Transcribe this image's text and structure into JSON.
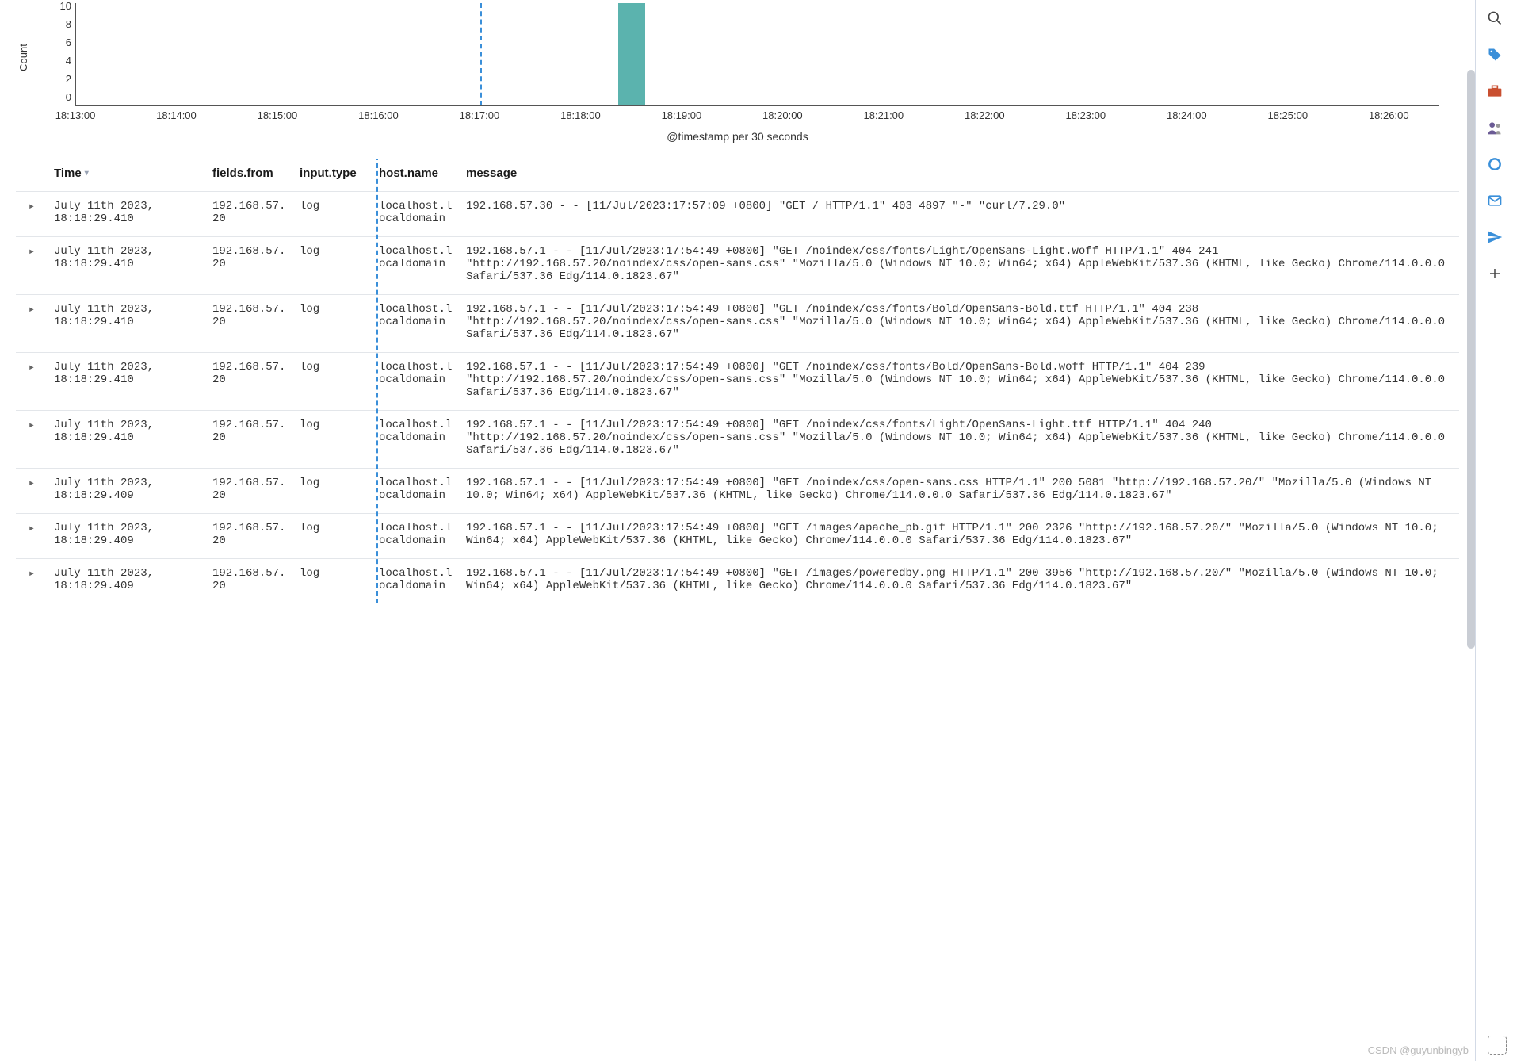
{
  "chart_data": {
    "type": "bar",
    "xlabel": "@timestamp per 30 seconds",
    "ylabel": "Count",
    "y_ticks": [
      10,
      8,
      6,
      4,
      2,
      0
    ],
    "x_ticks": [
      "18:13:00",
      "18:14:00",
      "18:15:00",
      "18:16:00",
      "18:17:00",
      "18:18:00",
      "18:19:00",
      "18:20:00",
      "18:21:00",
      "18:22:00",
      "18:23:00",
      "18:24:00",
      "18:25:00",
      "18:26:00"
    ],
    "x_range": [
      "18:13:00",
      "18:26:30"
    ],
    "ylim": [
      0,
      10
    ],
    "bars": [
      {
        "x": "18:18:30",
        "value": 10
      }
    ],
    "time_range_marker": "18:17:00"
  },
  "columns": {
    "time": "Time",
    "from": "fields.from",
    "type": "input.type",
    "host": "host.name",
    "message": "message"
  },
  "rows": [
    {
      "time": "July 11th 2023, 18:18:29.410",
      "from": "192.168.57.20",
      "type": "log",
      "host": "localhost.localdomain",
      "message": "192.168.57.30 - - [11/Jul/2023:17:57:09 +0800] \"GET / HTTP/1.1\" 403 4897 \"-\" \"curl/7.29.0\""
    },
    {
      "time": "July 11th 2023, 18:18:29.410",
      "from": "192.168.57.20",
      "type": "log",
      "host": "localhost.localdomain",
      "message": "192.168.57.1 - - [11/Jul/2023:17:54:49 +0800] \"GET /noindex/css/fonts/Light/OpenSans-Light.woff HTTP/1.1\" 404 241 \"http://192.168.57.20/noindex/css/open-sans.css\" \"Mozilla/5.0 (Windows NT 10.0; Win64; x64) AppleWebKit/537.36 (KHTML, like Gecko) Chrome/114.0.0.0 Safari/537.36 Edg/114.0.1823.67\""
    },
    {
      "time": "July 11th 2023, 18:18:29.410",
      "from": "192.168.57.20",
      "type": "log",
      "host": "localhost.localdomain",
      "message": "192.168.57.1 - - [11/Jul/2023:17:54:49 +0800] \"GET /noindex/css/fonts/Bold/OpenSans-Bold.ttf HTTP/1.1\" 404 238 \"http://192.168.57.20/noindex/css/open-sans.css\" \"Mozilla/5.0 (Windows NT 10.0; Win64; x64) AppleWebKit/537.36 (KHTML, like Gecko) Chrome/114.0.0.0 Safari/537.36 Edg/114.0.1823.67\""
    },
    {
      "time": "July 11th 2023, 18:18:29.410",
      "from": "192.168.57.20",
      "type": "log",
      "host": "localhost.localdomain",
      "message": "192.168.57.1 - - [11/Jul/2023:17:54:49 +0800] \"GET /noindex/css/fonts/Bold/OpenSans-Bold.woff HTTP/1.1\" 404 239 \"http://192.168.57.20/noindex/css/open-sans.css\" \"Mozilla/5.0 (Windows NT 10.0; Win64; x64) AppleWebKit/537.36 (KHTML, like Gecko) Chrome/114.0.0.0 Safari/537.36 Edg/114.0.1823.67\""
    },
    {
      "time": "July 11th 2023, 18:18:29.410",
      "from": "192.168.57.20",
      "type": "log",
      "host": "localhost.localdomain",
      "message": "192.168.57.1 - - [11/Jul/2023:17:54:49 +0800] \"GET /noindex/css/fonts/Light/OpenSans-Light.ttf HTTP/1.1\" 404 240 \"http://192.168.57.20/noindex/css/open-sans.css\" \"Mozilla/5.0 (Windows NT 10.0; Win64; x64) AppleWebKit/537.36 (KHTML, like Gecko) Chrome/114.0.0.0 Safari/537.36 Edg/114.0.1823.67\""
    },
    {
      "time": "July 11th 2023, 18:18:29.409",
      "from": "192.168.57.20",
      "type": "log",
      "host": "localhost.localdomain",
      "message": "192.168.57.1 - - [11/Jul/2023:17:54:49 +0800] \"GET /noindex/css/open-sans.css HTTP/1.1\" 200 5081 \"http://192.168.57.20/\" \"Mozilla/5.0 (Windows NT 10.0; Win64; x64) AppleWebKit/537.36 (KHTML, like Gecko) Chrome/114.0.0.0 Safari/537.36 Edg/114.0.1823.67\""
    },
    {
      "time": "July 11th 2023, 18:18:29.409",
      "from": "192.168.57.20",
      "type": "log",
      "host": "localhost.localdomain",
      "message": "192.168.57.1 - - [11/Jul/2023:17:54:49 +0800] \"GET /images/apache_pb.gif HTTP/1.1\" 200 2326 \"http://192.168.57.20/\" \"Mozilla/5.0 (Windows NT 10.0; Win64; x64) AppleWebKit/537.36 (KHTML, like Gecko) Chrome/114.0.0.0 Safari/537.36 Edg/114.0.1823.67\""
    },
    {
      "time": "July 11th 2023, 18:18:29.409",
      "from": "192.168.57.20",
      "type": "log",
      "host": "localhost.localdomain",
      "message": "192.168.57.1 - - [11/Jul/2023:17:54:49 +0800] \"GET /images/poweredby.png HTTP/1.1\" 200 3956 \"http://192.168.57.20/\" \"Mozilla/5.0 (Windows NT 10.0; Win64; x64) AppleWebKit/537.36 (KHTML, like Gecko) Chrome/114.0.0.0 Safari/537.36 Edg/114.0.1823.67\""
    }
  ],
  "sidebar_icons": [
    {
      "name": "search-icon",
      "color": "#444"
    },
    {
      "name": "tag-icon",
      "color": "#3a8fd9"
    },
    {
      "name": "briefcase-icon",
      "color": "#d9534f"
    },
    {
      "name": "people-icon",
      "color": "#444"
    },
    {
      "name": "circle-icon",
      "color": "#3a8fd9"
    },
    {
      "name": "mail-icon",
      "color": "#3a8fd9"
    },
    {
      "name": "send-icon",
      "color": "#3a8fd9"
    },
    {
      "name": "plus-icon",
      "color": "#444"
    }
  ],
  "watermark": "CSDN @guyunbingyb"
}
